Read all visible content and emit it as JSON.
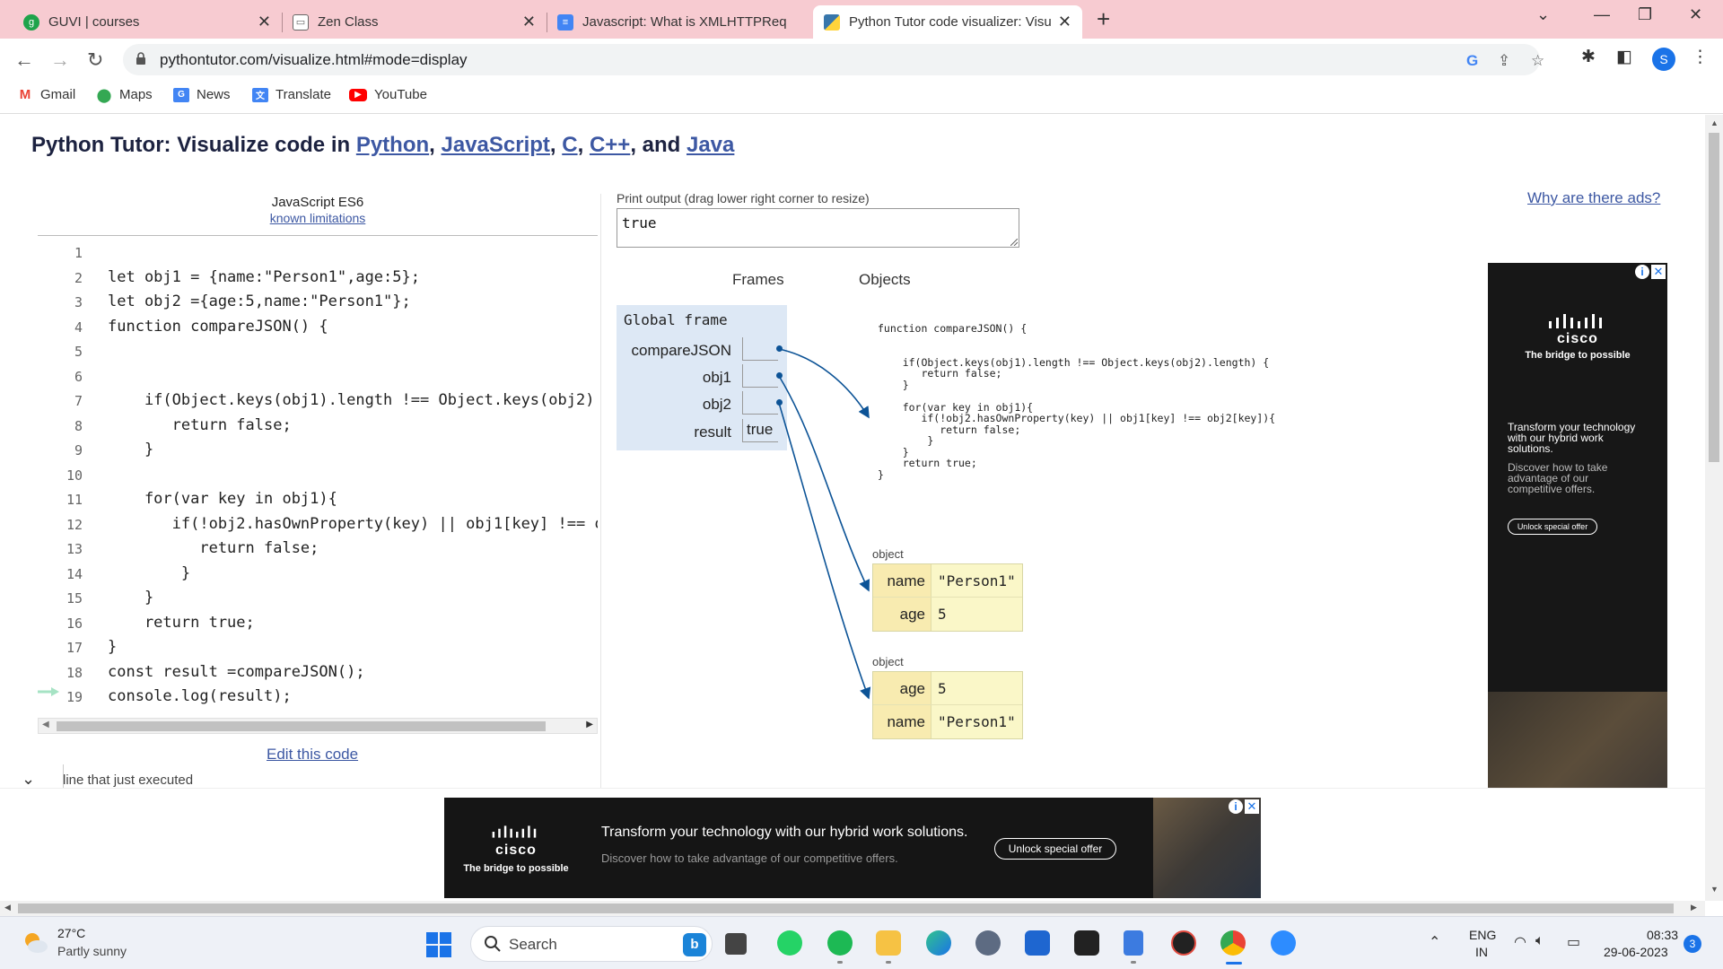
{
  "browser": {
    "tabs": [
      {
        "title": "GUVI | courses",
        "active": false,
        "icon": "guvi-icon"
      },
      {
        "title": "Zen Class",
        "active": false,
        "icon": "zen-icon"
      },
      {
        "title": "Javascript: What is XMLHTTPReq",
        "active": false,
        "icon": "doc-icon"
      },
      {
        "title": "Python Tutor code visualizer: Visu",
        "active": true,
        "icon": "python-icon"
      }
    ],
    "url": "pythontutor.com/visualize.html#mode=display",
    "profile_initial": "S",
    "bookmarks": [
      "Gmail",
      "Maps",
      "News",
      "Translate",
      "YouTube"
    ]
  },
  "page": {
    "title_prefix": "Python Tutor: Visualize code in ",
    "title_links": [
      "Python",
      "JavaScript",
      "C",
      "C++",
      "Java"
    ],
    "sep_comma": ", ",
    "sep_and": ", and ",
    "language": "JavaScript ES6",
    "known_limitations": "known limitations",
    "code_lines": [
      {
        "n": "1",
        "text": ""
      },
      {
        "n": "2",
        "text": "let obj1 = {name:\"Person1\",age:5};"
      },
      {
        "n": "3",
        "text": "let obj2 ={age:5,name:\"Person1\"};"
      },
      {
        "n": "4",
        "text": "function compareJSON() {"
      },
      {
        "n": "5",
        "text": ""
      },
      {
        "n": "6",
        "text": ""
      },
      {
        "n": "7",
        "text": "    if(Object.keys(obj1).length !== Object.keys(obj2)."
      },
      {
        "n": "8",
        "text": "       return false;"
      },
      {
        "n": "9",
        "text": "    }"
      },
      {
        "n": "10",
        "text": ""
      },
      {
        "n": "11",
        "text": "    for(var key in obj1){"
      },
      {
        "n": "12",
        "text": "       if(!obj2.hasOwnProperty(key) || obj1[key] !== o"
      },
      {
        "n": "13",
        "text": "          return false;"
      },
      {
        "n": "14",
        "text": "        }"
      },
      {
        "n": "15",
        "text": "    }"
      },
      {
        "n": "16",
        "text": "    return true;"
      },
      {
        "n": "17",
        "text": "}"
      },
      {
        "n": "18",
        "text": "const result =compareJSON();"
      },
      {
        "n": "19",
        "text": "console.log(result);"
      }
    ],
    "edit_code": "Edit this code",
    "legend": "line that just executed",
    "print_output_label": "Print output (drag lower right corner to resize)",
    "print_output": "true",
    "frames_header": "Frames",
    "objects_header": "Objects",
    "global_frame": {
      "title": "Global frame",
      "vars": [
        {
          "name": "compareJSON",
          "value": ""
        },
        {
          "name": "obj1",
          "value": ""
        },
        {
          "name": "obj2",
          "value": ""
        },
        {
          "name": "result",
          "value": "true"
        }
      ]
    },
    "function_object": "function compareJSON() {\n\n\n    if(Object.keys(obj1).length !== Object.keys(obj2).length) {\n       return false;\n    }\n\n    for(var key in obj1){\n       if(!obj2.hasOwnProperty(key) || obj1[key] !== obj2[key]){\n          return false;\n        }\n    }\n    return true;\n}",
    "objects": [
      {
        "label": "object",
        "rows": [
          {
            "k": "name",
            "v": "\"Person1\""
          },
          {
            "k": "age",
            "v": "5"
          }
        ]
      },
      {
        "label": "object",
        "rows": [
          {
            "k": "age",
            "v": "5"
          },
          {
            "k": "name",
            "v": "\"Person1\""
          }
        ]
      }
    ],
    "why_ads": "Why are there ads?"
  },
  "ads": {
    "side": {
      "logo": "cisco",
      "tagline": "The bridge to possible",
      "headline": "Transform your technology with our hybrid work solutions.",
      "sub": "Discover how to take advantage of our competitive offers.",
      "cta": "Unlock special offer"
    },
    "bottom": {
      "logo": "cisco",
      "tagline": "The bridge to possible",
      "headline": "Transform your technology with our hybrid work solutions.",
      "sub": "Discover how to take advantage of our competitive offers.",
      "cta": "Unlock special offer"
    }
  },
  "taskbar": {
    "weather_temp": "27°C",
    "weather_desc": "Partly sunny",
    "search_label": "Search",
    "lang_line1": "ENG",
    "lang_line2": "IN",
    "time": "08:33",
    "date": "29-06-2023",
    "notifications": "3"
  },
  "colors": {
    "tab_strip": "#f7cbd1",
    "link": "#3d58a3",
    "frame_bg": "#dde8f5",
    "object_bg": "#faf7c8",
    "arrow": "#0c5396"
  }
}
